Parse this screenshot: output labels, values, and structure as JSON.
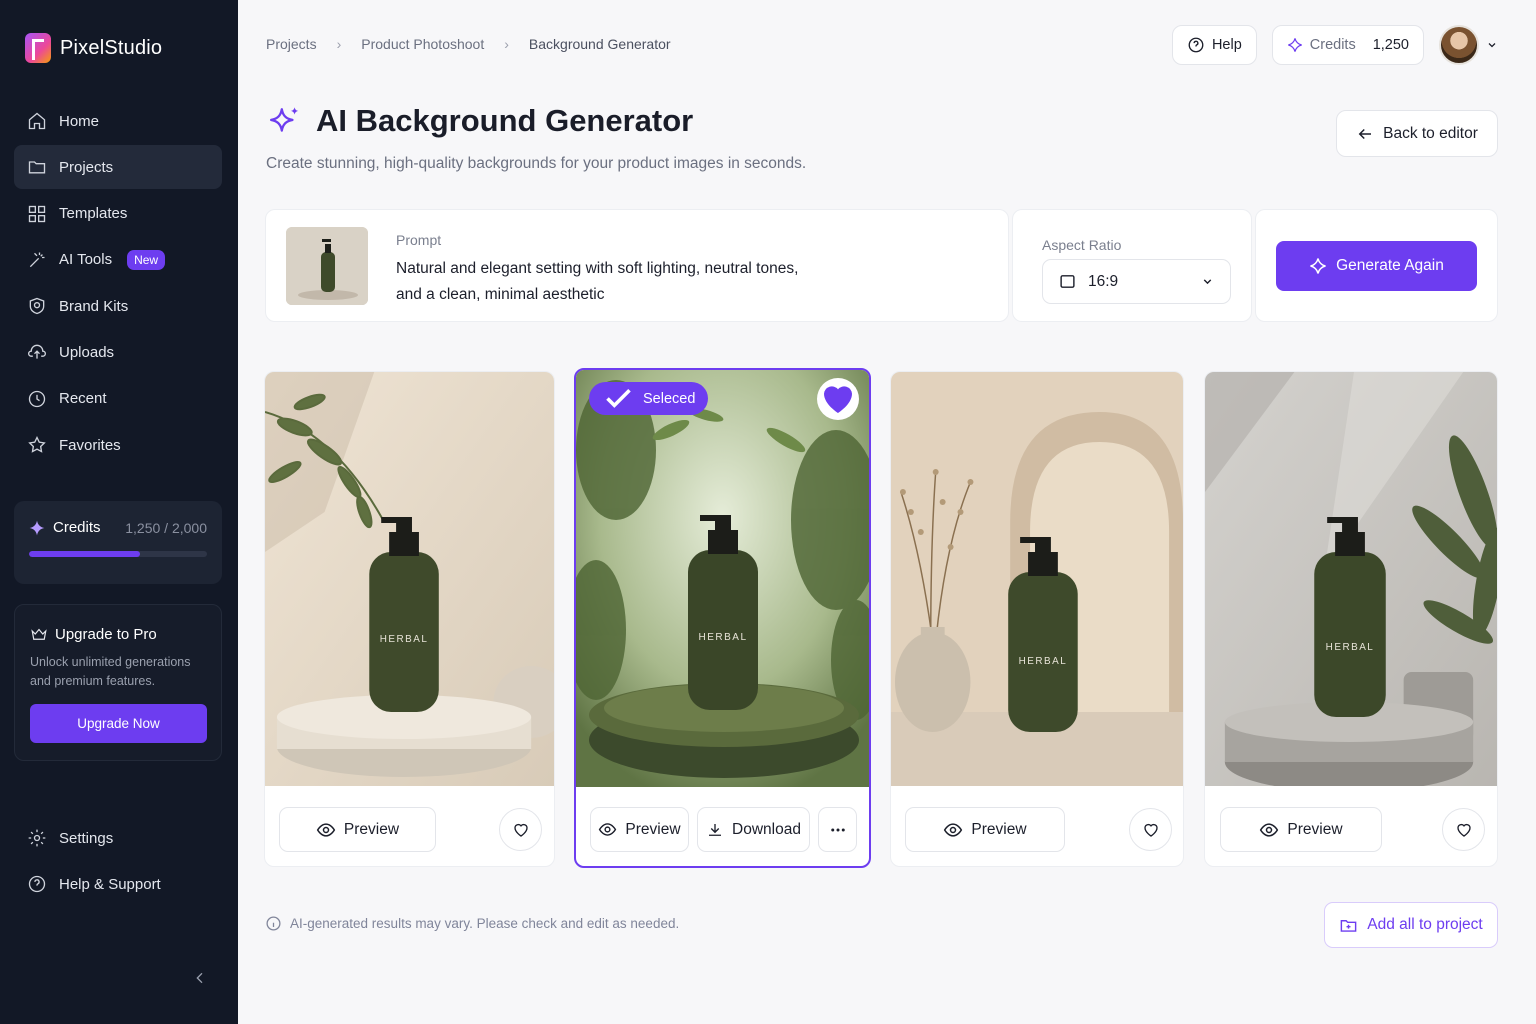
{
  "app": {
    "name": "PixelStudio"
  },
  "colors": {
    "accent": "#6d3df0",
    "sidebar_bg": "#121826",
    "page_bg": "#f7f7f9"
  },
  "sidebar": {
    "items": [
      {
        "label": "Home",
        "icon": "home-icon"
      },
      {
        "label": "Projects",
        "icon": "folder-icon",
        "active": true
      },
      {
        "label": "Templates",
        "icon": "grid-icon"
      },
      {
        "label": "AI Tools",
        "icon": "magic-wand-icon",
        "badge": "New"
      },
      {
        "label": "Brand Kits",
        "icon": "palette-icon"
      },
      {
        "label": "Uploads",
        "icon": "upload-icon"
      },
      {
        "label": "Recent",
        "icon": "clock-icon"
      },
      {
        "label": "Favorites",
        "icon": "star-icon"
      }
    ],
    "credits": {
      "label": "Credits",
      "value": "1,250 / 2,000",
      "progress": 0.625
    },
    "upgrade": {
      "title": "Upgrade to Pro",
      "description": "Unlock unlimited generations and premium features.",
      "button": "Upgrade Now"
    },
    "bottom_items": [
      {
        "label": "Settings",
        "icon": "gear-icon"
      },
      {
        "label": "Help & Support",
        "icon": "help-circle-icon"
      }
    ]
  },
  "breadcrumb": [
    "Projects",
    "Product Photoshoot",
    "Background Generator"
  ],
  "topbar": {
    "help": "Help",
    "credits_label": "Credits",
    "credits_value": "1,250"
  },
  "header": {
    "title": "AI Background Generator",
    "subtitle": "Create stunning, high-quality backgrounds for your product images in seconds.",
    "back_button": "Back to editor"
  },
  "prompt": {
    "label": "Prompt",
    "text_line1": "Natural and elegant setting with soft lighting, neutral tones,",
    "text_line2": "and a clean, minimal aesthetic"
  },
  "aspect_ratio": {
    "label": "Aspect Ratio",
    "value": "16:9"
  },
  "generate_button": "Generate Again",
  "results": [
    {
      "scene": "stone-pedestal-leaves",
      "preview": "Preview",
      "selected": false,
      "favorited": false
    },
    {
      "scene": "moss-rock-forest",
      "preview": "Preview",
      "download": "Download",
      "selected": true,
      "selected_label": "Seleced",
      "favorited": true
    },
    {
      "scene": "arch-vase-dried-flowers",
      "preview": "Preview",
      "selected": false,
      "favorited": false
    },
    {
      "scene": "concrete-plinth-plant",
      "preview": "Preview",
      "selected": false,
      "favorited": false
    }
  ],
  "product_label": "HERBAL",
  "footer": {
    "note": "AI-generated results may vary. Please check and edit as needed.",
    "add_all": "Add all to project"
  }
}
